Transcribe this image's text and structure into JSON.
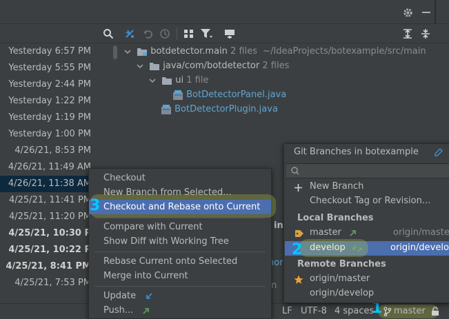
{
  "commits": [
    {
      "time": "Yesterday 6:57 PM",
      "bold": false,
      "selected": false
    },
    {
      "time": "Yesterday 5:55 PM",
      "bold": false,
      "selected": false
    },
    {
      "time": "Yesterday 2:44 PM",
      "bold": false,
      "selected": false
    },
    {
      "time": "Yesterday 1:22 PM",
      "bold": false,
      "selected": false
    },
    {
      "time": "Yesterday 1:19 PM",
      "bold": false,
      "selected": false
    },
    {
      "time": "Yesterday 1:00 PM",
      "bold": false,
      "selected": false
    },
    {
      "time": "4/26/21, 8:53 PM",
      "bold": false,
      "selected": false
    },
    {
      "time": "4/26/21, 11:49 AM",
      "bold": false,
      "selected": false
    },
    {
      "time": "4/26/21, 11:38 AM",
      "bold": false,
      "selected": true
    },
    {
      "time": "4/25/21, 11:41 PM",
      "bold": false,
      "selected": false
    },
    {
      "time": "4/25/21, 11:20 PM",
      "bold": false,
      "selected": false
    },
    {
      "time": "4/25/21, 10:30 P",
      "bold": true,
      "selected": false
    },
    {
      "time": "4/25/21, 10:22 P",
      "bold": true,
      "selected": false
    },
    {
      "time": "4/25/21, 8:41 PM",
      "bold": true,
      "selected": false
    },
    {
      "time": "4/25/21, 7:53 PM",
      "bold": false,
      "selected": false
    }
  ],
  "tree": {
    "root_name": "botdetector.main",
    "root_count": "2 files",
    "root_path": "~/IdeaProjects/botexample/src/main",
    "pkg_name": "java/com/botdetector",
    "pkg_count": "2 files",
    "ui_name": "ui",
    "ui_count": "1 file",
    "file1": "BotDetectorPanel.java",
    "file2": "BotDetectorPlugin.java"
  },
  "context_menu": {
    "checkout": "Checkout",
    "new_branch": "New Branch from Selected...",
    "checkout_rebase": "Checkout and Rebase onto Current",
    "compare": "Compare with Current",
    "show_diff": "Show Diff with Working Tree",
    "rebase": "Rebase Current onto Selected",
    "merge": "Merge into Current",
    "update": "Update",
    "push": "Push..."
  },
  "branches_popup": {
    "title": "Git Branches in botexample",
    "search_placeholder": "",
    "new_branch": "New Branch",
    "checkout_tag": "Checkout Tag or Revision...",
    "local_header": "Local Branches",
    "local": [
      {
        "name": "master",
        "tracking": "origin/master",
        "current": true,
        "selected": false
      },
      {
        "name": "develop",
        "tracking": "origin/develop",
        "current": false,
        "selected": true
      }
    ],
    "remote_header": "Remote Branches",
    "remote": [
      {
        "name": "origin/master",
        "favorite": true
      },
      {
        "name": "origin/develop",
        "favorite": false
      }
    ]
  },
  "background_fragments": {
    "in": "in",
    "hor": "hor",
    "n": "n"
  },
  "statusbar": {
    "line_sep": "LF",
    "encoding": "UTF-8",
    "indent": "4 spaces",
    "branch": "master"
  },
  "annotations": {
    "step1": "1",
    "step2": "2",
    "step3": "3"
  },
  "colors": {
    "accent": "#4b6eaf",
    "selection": "#0d293e",
    "highlight": "#bccd3c",
    "badge": "#00c8ff",
    "file_blue": "#5ea6d4",
    "incoming_blue": "#3d8fd6",
    "outgoing_green": "#5fa55b"
  }
}
